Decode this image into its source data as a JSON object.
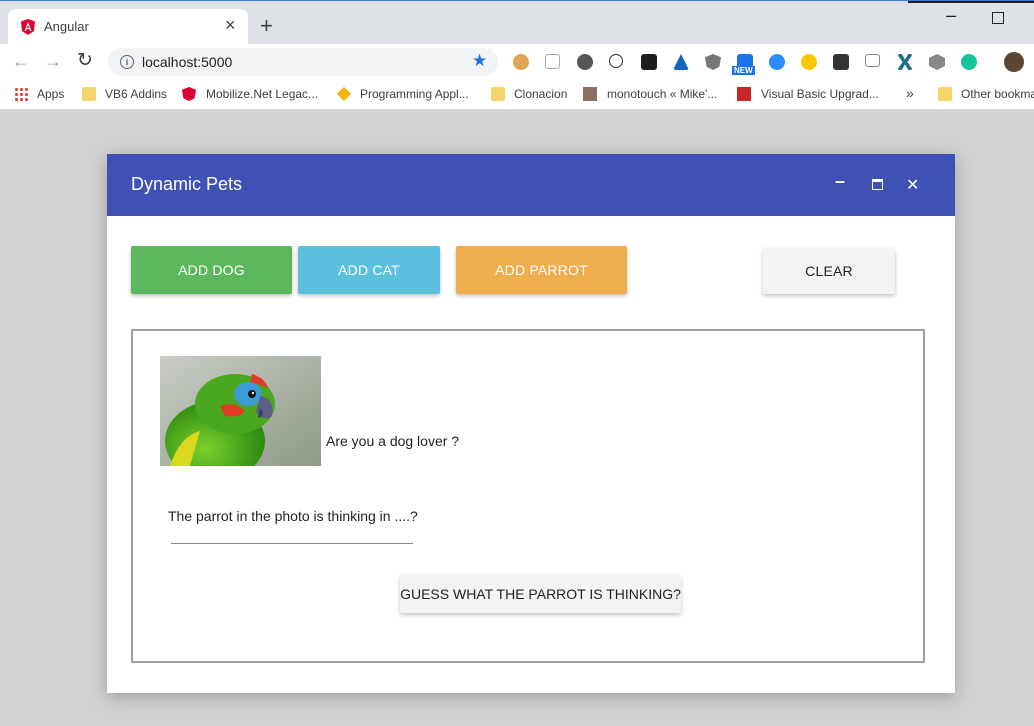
{
  "browser": {
    "tab_title": "Angular",
    "url": "localhost:5000",
    "bookmarks": [
      {
        "label": "Apps"
      },
      {
        "label": "VB6 Addins"
      },
      {
        "label": "Mobilize.Net Legac..."
      },
      {
        "label": "Programming Appl..."
      },
      {
        "label": "Clonacion"
      },
      {
        "label": "monotouch « Mike'..."
      },
      {
        "label": "Visual Basic Upgrad..."
      },
      {
        "label": "Other bookmarks"
      }
    ],
    "new_badge": "NEW"
  },
  "dialog": {
    "title": "Dynamic Pets",
    "buttons": {
      "add_dog": "ADD DOG",
      "add_cat": "ADD CAT",
      "add_parrot": "ADD PARROT",
      "clear": "CLEAR"
    },
    "pet": {
      "question": "Are you a dog lover ?",
      "thinking_label": "The parrot in the photo is thinking in ....?",
      "answer_value": "",
      "guess_button": "GUESS WHAT THE PARROT IS THINKING?"
    }
  },
  "colors": {
    "header": "#3f51b5",
    "dog": "#5cb85c",
    "cat": "#5bc0de",
    "parrot": "#f0ad4e"
  }
}
